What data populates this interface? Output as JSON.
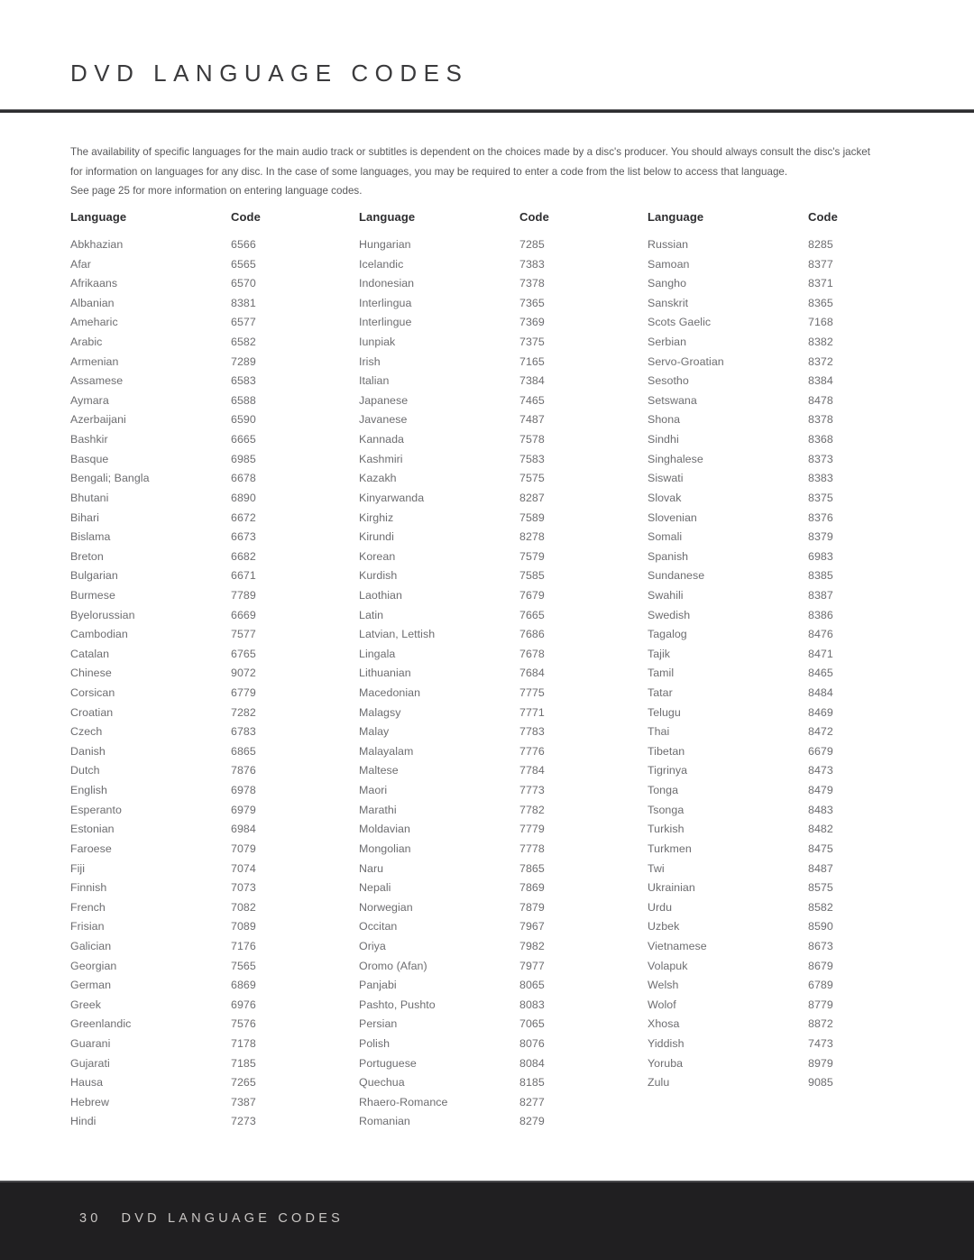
{
  "header": {
    "title": "DVD LANGUAGE CODES"
  },
  "intro": {
    "line1": "The availability of specific languages for the main audio track or subtitles is dependent on the choices made by a disc's producer. You should always consult the disc's jacket",
    "line2": "for information on languages for any disc. In the case of some languages, you may be required to enter a code from the list below to access that language.",
    "line3": "See page 25 for more information on entering language codes."
  },
  "table": {
    "headers": {
      "language": "Language",
      "code": "Code"
    },
    "columns": [
      {
        "rows": [
          {
            "language": "Abkhazian",
            "code": "6566"
          },
          {
            "language": "Afar",
            "code": "6565"
          },
          {
            "language": "Afrikaans",
            "code": "6570"
          },
          {
            "language": "Albanian",
            "code": "8381"
          },
          {
            "language": "Ameharic",
            "code": "6577"
          },
          {
            "language": "Arabic",
            "code": "6582"
          },
          {
            "language": "Armenian",
            "code": "7289"
          },
          {
            "language": "Assamese",
            "code": "6583"
          },
          {
            "language": "Aymara",
            "code": "6588"
          },
          {
            "language": "Azerbaijani",
            "code": "6590"
          },
          {
            "language": "Bashkir",
            "code": "6665"
          },
          {
            "language": "Basque",
            "code": "6985"
          },
          {
            "language": "Bengali; Bangla",
            "code": "6678"
          },
          {
            "language": "Bhutani",
            "code": "6890"
          },
          {
            "language": "Bihari",
            "code": "6672"
          },
          {
            "language": "Bislama",
            "code": "6673"
          },
          {
            "language": "Breton",
            "code": "6682"
          },
          {
            "language": "Bulgarian",
            "code": "6671"
          },
          {
            "language": "Burmese",
            "code": "7789"
          },
          {
            "language": "Byelorussian",
            "code": "6669"
          },
          {
            "language": "Cambodian",
            "code": "7577"
          },
          {
            "language": "Catalan",
            "code": "6765"
          },
          {
            "language": "Chinese",
            "code": "9072"
          },
          {
            "language": "Corsican",
            "code": "6779"
          },
          {
            "language": "Croatian",
            "code": "7282"
          },
          {
            "language": "Czech",
            "code": "6783"
          },
          {
            "language": "Danish",
            "code": "6865"
          },
          {
            "language": "Dutch",
            "code": "7876"
          },
          {
            "language": "English",
            "code": "6978"
          },
          {
            "language": "Esperanto",
            "code": "6979"
          },
          {
            "language": "Estonian",
            "code": "6984"
          },
          {
            "language": "Faroese",
            "code": "7079"
          },
          {
            "language": "Fiji",
            "code": "7074"
          },
          {
            "language": "Finnish",
            "code": "7073"
          },
          {
            "language": "French",
            "code": "7082"
          },
          {
            "language": "Frisian",
            "code": "7089"
          },
          {
            "language": "Galician",
            "code": "7176"
          },
          {
            "language": "Georgian",
            "code": "7565"
          },
          {
            "language": "German",
            "code": "6869"
          },
          {
            "language": "Greek",
            "code": "6976"
          },
          {
            "language": "Greenlandic",
            "code": "7576"
          },
          {
            "language": "Guarani",
            "code": "7178"
          },
          {
            "language": "Gujarati",
            "code": "7185"
          },
          {
            "language": "Hausa",
            "code": "7265"
          },
          {
            "language": "Hebrew",
            "code": "7387"
          },
          {
            "language": "Hindi",
            "code": "7273"
          }
        ]
      },
      {
        "rows": [
          {
            "language": "Hungarian",
            "code": "7285"
          },
          {
            "language": "Icelandic",
            "code": "7383"
          },
          {
            "language": "Indonesian",
            "code": "7378"
          },
          {
            "language": "Interlingua",
            "code": "7365"
          },
          {
            "language": "Interlingue",
            "code": "7369"
          },
          {
            "language": "Iunpiak",
            "code": "7375"
          },
          {
            "language": "Irish",
            "code": "7165"
          },
          {
            "language": "Italian",
            "code": "7384"
          },
          {
            "language": "Japanese",
            "code": "7465"
          },
          {
            "language": "Javanese",
            "code": "7487"
          },
          {
            "language": "Kannada",
            "code": "7578"
          },
          {
            "language": "Kashmiri",
            "code": "7583"
          },
          {
            "language": "Kazakh",
            "code": "7575"
          },
          {
            "language": "Kinyarwanda",
            "code": "8287"
          },
          {
            "language": "Kirghiz",
            "code": "7589"
          },
          {
            "language": "Kirundi",
            "code": "8278"
          },
          {
            "language": "Korean",
            "code": "7579"
          },
          {
            "language": "Kurdish",
            "code": "7585"
          },
          {
            "language": "Laothian",
            "code": "7679"
          },
          {
            "language": "Latin",
            "code": "7665"
          },
          {
            "language": "Latvian, Lettish",
            "code": "7686"
          },
          {
            "language": "Lingala",
            "code": "7678"
          },
          {
            "language": "Lithuanian",
            "code": "7684"
          },
          {
            "language": "Macedonian",
            "code": "7775"
          },
          {
            "language": "Malagsy",
            "code": "7771"
          },
          {
            "language": "Malay",
            "code": "7783"
          },
          {
            "language": "Malayalam",
            "code": "7776"
          },
          {
            "language": "Maltese",
            "code": "7784"
          },
          {
            "language": "Maori",
            "code": "7773"
          },
          {
            "language": "Marathi",
            "code": "7782"
          },
          {
            "language": "Moldavian",
            "code": "7779"
          },
          {
            "language": "Mongolian",
            "code": "7778"
          },
          {
            "language": "Naru",
            "code": "7865"
          },
          {
            "language": "Nepali",
            "code": "7869"
          },
          {
            "language": "Norwegian",
            "code": "7879"
          },
          {
            "language": "Occitan",
            "code": "7967"
          },
          {
            "language": "Oriya",
            "code": "7982"
          },
          {
            "language": "Oromo (Afan)",
            "code": "7977"
          },
          {
            "language": "Panjabi",
            "code": "8065"
          },
          {
            "language": "Pashto, Pushto",
            "code": "8083"
          },
          {
            "language": "Persian",
            "code": "7065"
          },
          {
            "language": "Polish",
            "code": "8076"
          },
          {
            "language": "Portuguese",
            "code": "8084"
          },
          {
            "language": "Quechua",
            "code": "8185"
          },
          {
            "language": "Rhaero-Romance",
            "code": "8277"
          },
          {
            "language": "Romanian",
            "code": "8279"
          }
        ]
      },
      {
        "rows": [
          {
            "language": "Russian",
            "code": "8285"
          },
          {
            "language": "Samoan",
            "code": "8377"
          },
          {
            "language": "Sangho",
            "code": "8371"
          },
          {
            "language": "Sanskrit",
            "code": "8365"
          },
          {
            "language": "Scots Gaelic",
            "code": "7168"
          },
          {
            "language": "Serbian",
            "code": "8382"
          },
          {
            "language": "Servo-Groatian",
            "code": "8372"
          },
          {
            "language": "Sesotho",
            "code": "8384"
          },
          {
            "language": "Setswana",
            "code": "8478"
          },
          {
            "language": "Shona",
            "code": "8378"
          },
          {
            "language": "Sindhi",
            "code": "8368"
          },
          {
            "language": "Singhalese",
            "code": "8373"
          },
          {
            "language": "Siswati",
            "code": "8383"
          },
          {
            "language": "Slovak",
            "code": "8375"
          },
          {
            "language": "Slovenian",
            "code": "8376"
          },
          {
            "language": "Somali",
            "code": "8379"
          },
          {
            "language": "Spanish",
            "code": "6983"
          },
          {
            "language": "Sundanese",
            "code": "8385"
          },
          {
            "language": "Swahili",
            "code": "8387"
          },
          {
            "language": "Swedish",
            "code": "8386"
          },
          {
            "language": "Tagalog",
            "code": "8476"
          },
          {
            "language": "Tajik",
            "code": "8471"
          },
          {
            "language": "Tamil",
            "code": "8465"
          },
          {
            "language": "Tatar",
            "code": "8484"
          },
          {
            "language": "Telugu",
            "code": "8469"
          },
          {
            "language": "Thai",
            "code": "8472"
          },
          {
            "language": "Tibetan",
            "code": "6679"
          },
          {
            "language": "Tigrinya",
            "code": "8473"
          },
          {
            "language": "Tonga",
            "code": "8479"
          },
          {
            "language": "Tsonga",
            "code": "8483"
          },
          {
            "language": "Turkish",
            "code": "8482"
          },
          {
            "language": "Turkmen",
            "code": "8475"
          },
          {
            "language": "Twi",
            "code": "8487"
          },
          {
            "language": "Ukrainian",
            "code": "8575"
          },
          {
            "language": "Urdu",
            "code": "8582"
          },
          {
            "language": "Uzbek",
            "code": "8590"
          },
          {
            "language": "Vietnamese",
            "code": "8673"
          },
          {
            "language": "Volapuk",
            "code": "8679"
          },
          {
            "language": "Welsh",
            "code": "6789"
          },
          {
            "language": "Wolof",
            "code": "8779"
          },
          {
            "language": "Xhosa",
            "code": "8872"
          },
          {
            "language": "Yiddish",
            "code": "7473"
          },
          {
            "language": "Yoruba",
            "code": "8979"
          },
          {
            "language": "Zulu",
            "code": "9085"
          }
        ]
      }
    ]
  },
  "footer": {
    "page_number": "30",
    "section_title": "DVD LANGUAGE CODES"
  }
}
